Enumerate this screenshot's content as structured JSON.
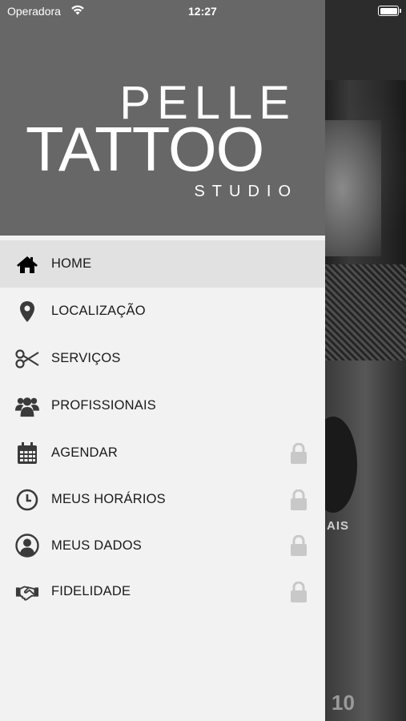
{
  "status_bar": {
    "carrier": "Operadora",
    "time": "12:27"
  },
  "brand": {
    "line1": "PELLE",
    "line2": "TATTOO",
    "line3": "STUDIO"
  },
  "menu": {
    "items": [
      {
        "label": "HOME",
        "icon": "home-icon",
        "active": true,
        "locked": false
      },
      {
        "label": "LOCALIZAÇÃO",
        "icon": "map-pin-icon",
        "active": false,
        "locked": false
      },
      {
        "label": "SERVIÇOS",
        "icon": "scissors-icon",
        "active": false,
        "locked": false
      },
      {
        "label": "PROFISSIONAIS",
        "icon": "users-icon",
        "active": false,
        "locked": false
      },
      {
        "label": "AGENDAR",
        "icon": "calendar-icon",
        "active": false,
        "locked": true
      },
      {
        "label": "MEUS HORÁRIOS",
        "icon": "clock-icon",
        "active": false,
        "locked": true
      },
      {
        "label": "MEUS DADOS",
        "icon": "user-circle-icon",
        "active": false,
        "locked": true
      },
      {
        "label": "FIDELIDADE",
        "icon": "handshake-icon",
        "active": false,
        "locked": true
      }
    ]
  },
  "background": {
    "partial_text": "AIS",
    "bottom_text": "10"
  },
  "colors": {
    "drawer_header": "#676767",
    "drawer_bg": "#f2f2f2",
    "active_item": "#e1e1e1",
    "lock": "#c8c8c8"
  }
}
